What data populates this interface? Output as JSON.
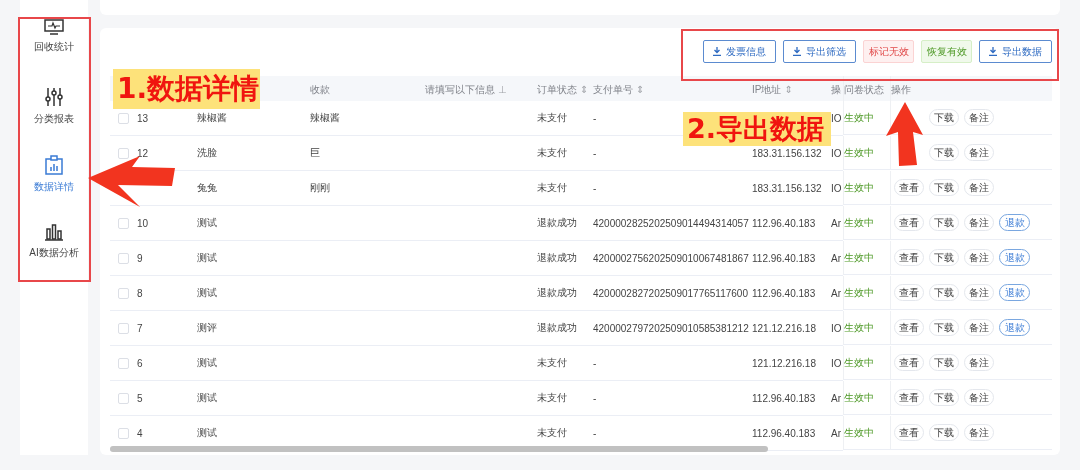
{
  "sidebar": {
    "items": [
      {
        "label": "回收统计",
        "selected": false
      },
      {
        "label": "分类报表",
        "selected": false
      },
      {
        "label": "数据详情",
        "selected": true
      },
      {
        "label": "AI数据分析",
        "selected": false
      }
    ]
  },
  "toolbar": {
    "buttons": [
      {
        "label": "发票信息",
        "kind": "download"
      },
      {
        "label": "导出筛选",
        "kind": "download"
      },
      {
        "label": "标记无效",
        "kind": "danger"
      },
      {
        "label": "恢复有效",
        "kind": "success"
      },
      {
        "label": "导出数据",
        "kind": "download"
      }
    ]
  },
  "table": {
    "columns": [
      {
        "label": "收款"
      },
      {
        "label": "请填写以下信息",
        "marker": "⊥"
      },
      {
        "label": "订单状态",
        "marker": "⇕"
      },
      {
        "label": "支付单号",
        "marker": "⇕"
      },
      {
        "label": "IP地址",
        "marker": "⇕"
      },
      {
        "label": "操"
      },
      {
        "label": "问卷状态"
      },
      {
        "label": "操作"
      }
    ],
    "rows": [
      {
        "checked": false,
        "id": "13",
        "name": "辣椒酱",
        "payee": "辣椒酱",
        "order_status": "未支付",
        "pay_no": "-",
        "os": "IO",
        "survey_status": "生效中",
        "actions": [
          "下载",
          "备注"
        ]
      },
      {
        "checked": false,
        "id": "12",
        "name": "洗脸",
        "payee": "巨",
        "order_status": "未支付",
        "pay_no": "-",
        "ip": "183.31.156.132",
        "os": "IO",
        "survey_status": "生效中",
        "actions": [
          "下载",
          "备注"
        ]
      },
      {
        "name": "兔兔",
        "payee": "刚刚",
        "order_status": "未支付",
        "pay_no": "-",
        "ip": "183.31.156.132",
        "os": "IO",
        "survey_status": "生效中",
        "actions": [
          "查看",
          "下载",
          "备注"
        ]
      },
      {
        "checked": false,
        "id": "10",
        "name": "测试",
        "order_status": "退款成功",
        "pay_no": "4200002825202509014494314057",
        "ip": "112.96.40.183",
        "os": "Ar",
        "survey_status": "生效中",
        "actions": [
          "查看",
          "下载",
          "备注"
        ],
        "refund": "退款"
      },
      {
        "checked": false,
        "id": "9",
        "name": "测试",
        "order_status": "退款成功",
        "pay_no": "4200002756202509010067481867",
        "ip": "112.96.40.183",
        "os": "Ar",
        "survey_status": "生效中",
        "actions": [
          "查看",
          "下载",
          "备注"
        ],
        "refund": "退款"
      },
      {
        "checked": false,
        "id": "8",
        "name": "测试",
        "order_status": "退款成功",
        "pay_no": "4200002827202509017765117600",
        "ip": "112.96.40.183",
        "os": "Ar",
        "survey_status": "生效中",
        "actions": [
          "查看",
          "下载",
          "备注"
        ],
        "refund": "退款"
      },
      {
        "checked": false,
        "id": "7",
        "name": "测评",
        "order_status": "退款成功",
        "pay_no": "4200002797202509010585381212",
        "ip": "121.12.216.18",
        "os": "IO",
        "survey_status": "生效中",
        "actions": [
          "查看",
          "下载",
          "备注"
        ],
        "refund": "退款"
      },
      {
        "checked": false,
        "id": "6",
        "name": "测试",
        "order_status": "未支付",
        "pay_no": "-",
        "ip": "121.12.216.18",
        "os": "IO",
        "survey_status": "生效中",
        "actions": [
          "查看",
          "下载",
          "备注"
        ]
      },
      {
        "checked": false,
        "id": "5",
        "name": "测试",
        "order_status": "未支付",
        "pay_no": "-",
        "ip": "112.96.40.183",
        "os": "Ar",
        "survey_status": "生效中",
        "actions": [
          "查看",
          "下载",
          "备注"
        ]
      },
      {
        "checked": false,
        "id": "4",
        "name": "测试",
        "order_status": "未支付",
        "pay_no": "-",
        "ip": "112.96.40.183",
        "os": "Ar",
        "survey_status": "生效中",
        "actions": [
          "查看",
          "下载",
          "备注"
        ]
      }
    ]
  },
  "annotations": [
    {
      "label": "1.数据详情"
    },
    {
      "label": "2.导出数据"
    }
  ]
}
